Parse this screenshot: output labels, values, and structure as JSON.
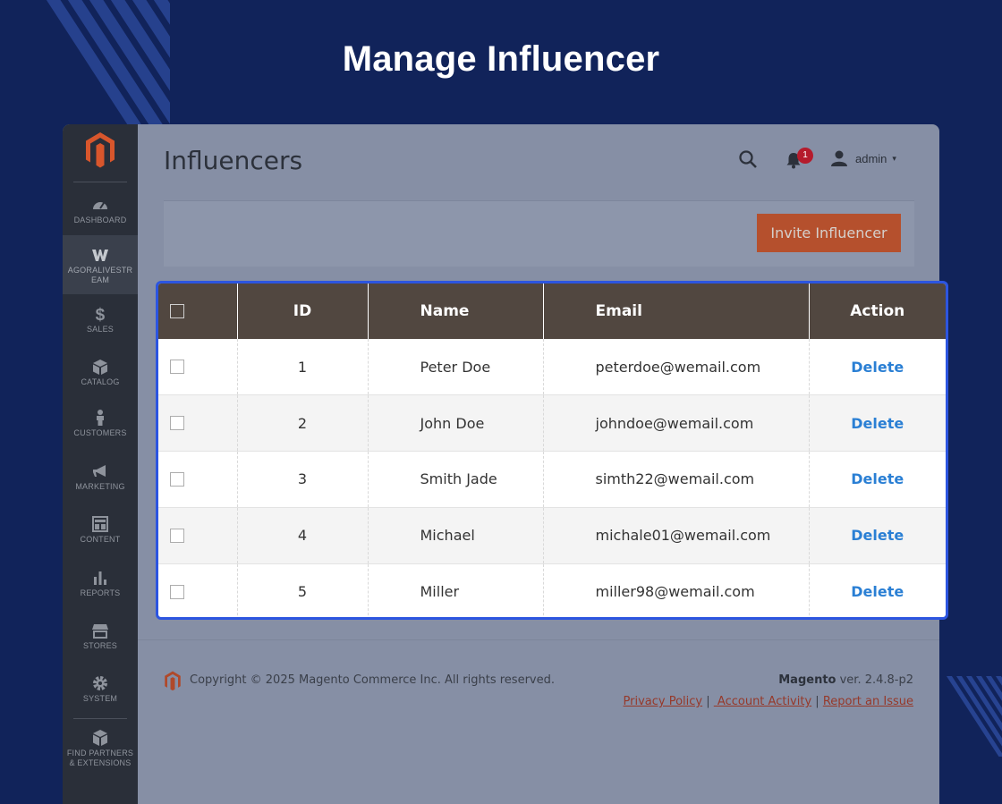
{
  "page": {
    "heading": "Manage Influencer"
  },
  "sidebar": {
    "items": [
      {
        "id": "dashboard",
        "label": "DASHBOARD",
        "icon": "dashboard-icon"
      },
      {
        "id": "agoralivestream",
        "label_line1": "AGORALIVESTR",
        "label_line2": "EAM",
        "icon": "agora-w-icon",
        "active": true
      },
      {
        "id": "sales",
        "label": "SALES",
        "icon": "dollar-icon"
      },
      {
        "id": "catalog",
        "label": "CATALOG",
        "icon": "box-icon"
      },
      {
        "id": "customers",
        "label": "CUSTOMERS",
        "icon": "person-icon"
      },
      {
        "id": "marketing",
        "label": "MARKETING",
        "icon": "megaphone-icon"
      },
      {
        "id": "content",
        "label": "CONTENT",
        "icon": "layout-icon"
      },
      {
        "id": "reports",
        "label": "REPORTS",
        "icon": "bar-chart-icon"
      },
      {
        "id": "stores",
        "label": "STORES",
        "icon": "store-icon"
      },
      {
        "id": "system",
        "label": "SYSTEM",
        "icon": "gear-icon"
      },
      {
        "id": "partners",
        "label_line1": "FIND PARTNERS",
        "label_line2": "& EXTENSIONS",
        "icon": "cubes-icon"
      }
    ]
  },
  "header": {
    "title": "Influencers",
    "notification_count": "1",
    "user_name": "admin",
    "caret": "▾"
  },
  "toolbar": {
    "invite_label": "Invite Influencer"
  },
  "table": {
    "columns": {
      "id": "ID",
      "name": "Name",
      "email": "Email",
      "action": "Action"
    },
    "rows": [
      {
        "id": "1",
        "name": "Peter Doe",
        "email": "peterdoe@wemail.com",
        "action": "Delete"
      },
      {
        "id": "2",
        "name": "John Doe",
        "email": "johndoe@wemail.com",
        "action": "Delete"
      },
      {
        "id": "3",
        "name": "Smith Jade",
        "email": "simth22@wemail.com",
        "action": "Delete"
      },
      {
        "id": "4",
        "name": "Michael",
        "email": "michale01@wemail.com",
        "action": "Delete"
      },
      {
        "id": "5",
        "name": "Miller",
        "email": "miller98@wemail.com",
        "action": "Delete"
      }
    ]
  },
  "footer": {
    "copyright": "Copyright © 2025 Magento Commerce Inc. All rights reserved.",
    "brand": "Magento",
    "version": " ver. 2.4.8-p2",
    "links": {
      "privacy": "Privacy Policy",
      "separator": " | ",
      "activity": " Account Activity",
      "report": "Report an Issue"
    }
  },
  "colors": {
    "background": "#11235a",
    "table_header": "#514740",
    "accent_button": "#b5502d",
    "link": "#2a7fd4",
    "highlight_border": "#2c55e0"
  }
}
